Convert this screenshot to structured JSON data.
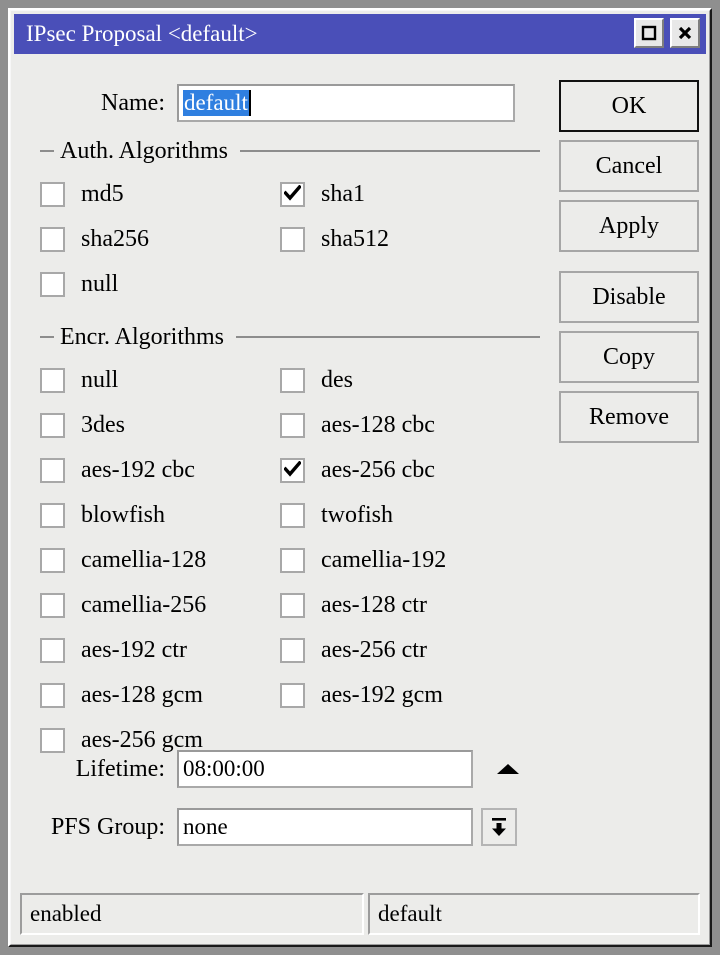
{
  "window": {
    "title": "IPsec Proposal <default>",
    "accent_color": "#4a4fb8",
    "controls": [
      {
        "name": "maximize",
        "glyph": "square"
      },
      {
        "name": "close",
        "glyph": "x"
      }
    ]
  },
  "form": {
    "name_label": "Name:",
    "name_value": "default",
    "name_placeholder": "",
    "name_selected": true,
    "lifetime_label": "Lifetime:",
    "lifetime_value": "08:00:00",
    "pfs_label": "PFS Group:",
    "pfs_value": "none"
  },
  "auth_group": {
    "title": "Auth. Algorithms",
    "rows": [
      [
        {
          "label": "md5",
          "checked": false
        },
        {
          "label": "sha1",
          "checked": true
        }
      ],
      [
        {
          "label": "sha256",
          "checked": false
        },
        {
          "label": "sha512",
          "checked": false
        }
      ],
      [
        {
          "label": "null",
          "checked": false
        },
        {
          "label": "",
          "checked": false,
          "empty": true
        }
      ]
    ]
  },
  "encr_group": {
    "title": "Encr. Algorithms",
    "rows": [
      [
        {
          "label": "null",
          "checked": false
        },
        {
          "label": "des",
          "checked": false
        }
      ],
      [
        {
          "label": "3des",
          "checked": false
        },
        {
          "label": "aes-128 cbc",
          "checked": false
        }
      ],
      [
        {
          "label": "aes-192 cbc",
          "checked": false
        },
        {
          "label": "aes-256 cbc",
          "checked": true
        }
      ],
      [
        {
          "label": "blowfish",
          "checked": false
        },
        {
          "label": "twofish",
          "checked": false
        }
      ],
      [
        {
          "label": "camellia-128",
          "checked": false
        },
        {
          "label": "camellia-192",
          "checked": false
        }
      ],
      [
        {
          "label": "camellia-256",
          "checked": false
        },
        {
          "label": "aes-128 ctr",
          "checked": false
        }
      ],
      [
        {
          "label": "aes-192 ctr",
          "checked": false
        },
        {
          "label": "aes-256 ctr",
          "checked": false
        }
      ],
      [
        {
          "label": "aes-128 gcm",
          "checked": false
        },
        {
          "label": "aes-192 gcm",
          "checked": false
        }
      ],
      [
        {
          "label": "aes-256 gcm",
          "checked": false
        },
        {
          "label": "",
          "checked": false,
          "empty": true
        }
      ]
    ]
  },
  "buttons": [
    {
      "label": "OK",
      "default": true
    },
    {
      "label": "Cancel",
      "default": false
    },
    {
      "label": "Apply",
      "default": false
    },
    {
      "label": "Disable",
      "default": false
    },
    {
      "label": "Copy",
      "default": false
    },
    {
      "label": "Remove",
      "default": false
    }
  ],
  "statusbar": {
    "left": "enabled",
    "right": "default"
  }
}
